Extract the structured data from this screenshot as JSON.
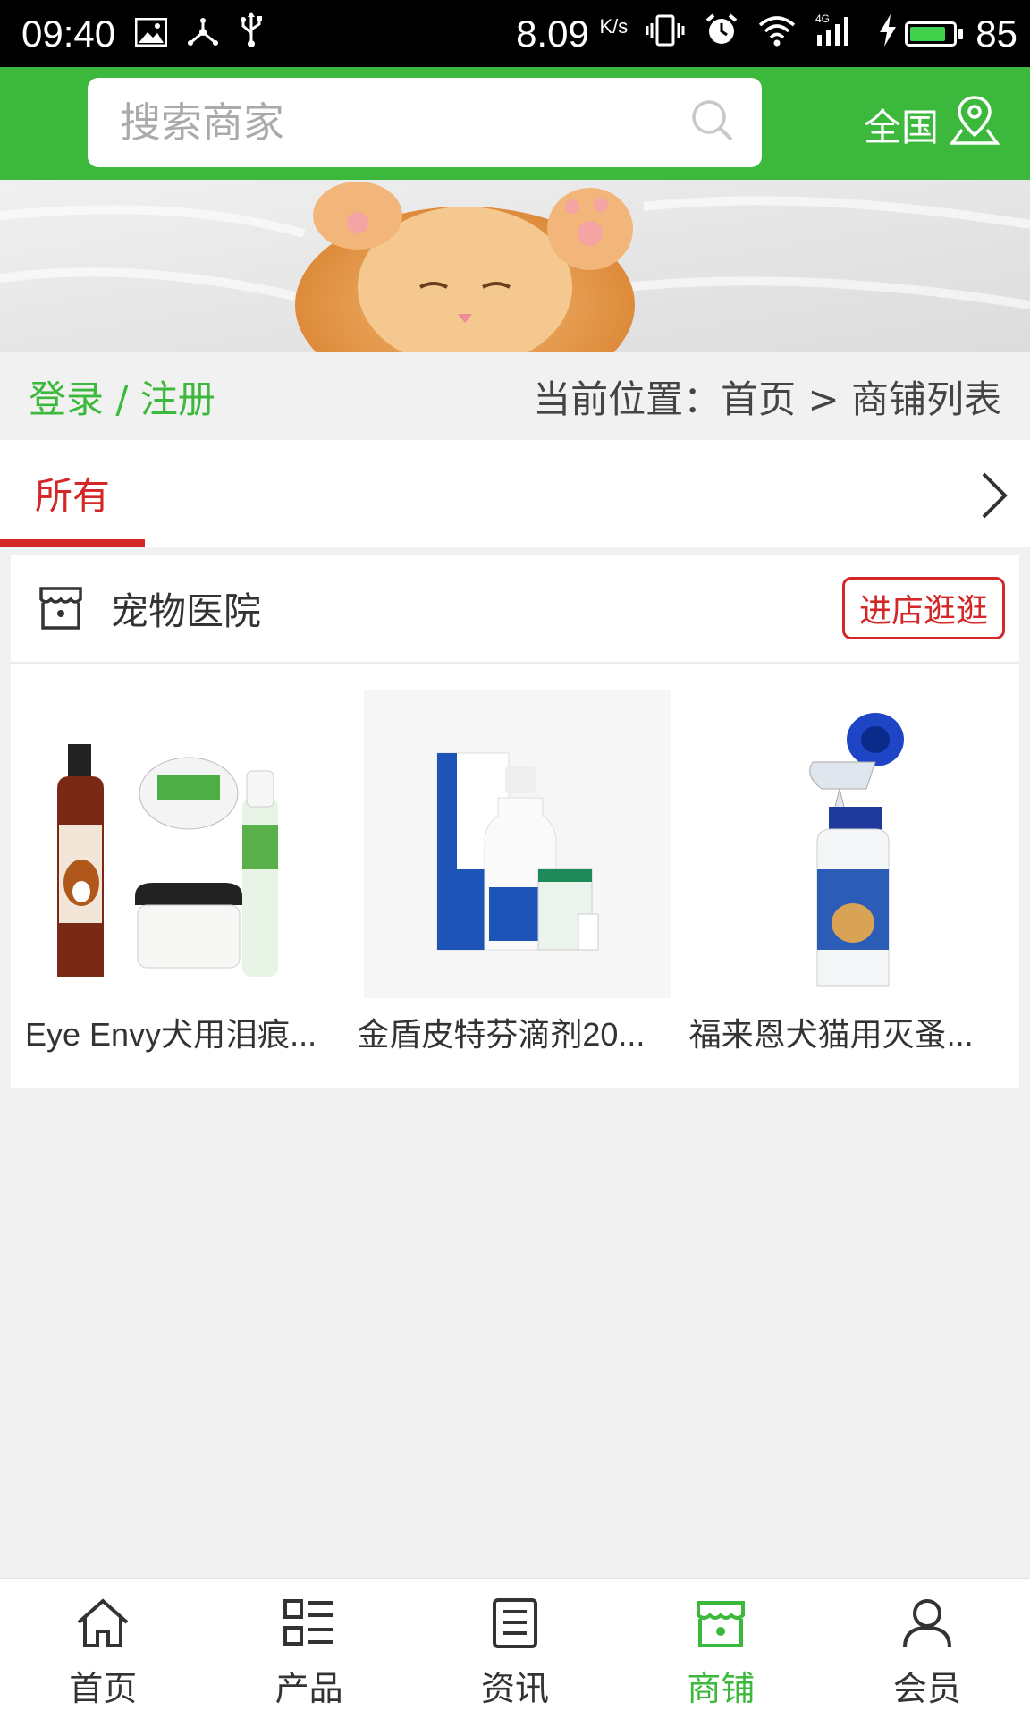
{
  "status_bar": {
    "time": "09:40",
    "speed": "8.09",
    "speed_unit": "K/s",
    "battery": "85",
    "battery_level": 0.85,
    "icons": [
      "image-icon",
      "share-network-icon",
      "usb-icon",
      "vibrate-icon",
      "alarm-icon",
      "wifi-icon",
      "signal-4g-icon",
      "charging-icon"
    ]
  },
  "header": {
    "search_placeholder": "搜索商家",
    "region_label": "全国",
    "accent_color": "#3cb93c"
  },
  "crumb": {
    "login_register": "登录 / 注册",
    "location": "当前位置：首页 > 商铺列表"
  },
  "tabs": {
    "active": "所有",
    "active_color": "#d42727"
  },
  "shop": {
    "name": "宠物医院",
    "visit_label": "进店逛逛",
    "products": [
      {
        "name": "Eye Envy犬用泪痕..."
      },
      {
        "name": "金盾皮特芬滴剂20..."
      },
      {
        "name": "福来恩犬猫用灭蚤..."
      }
    ]
  },
  "bottom_nav": [
    {
      "label": "首页",
      "icon": "home-icon"
    },
    {
      "label": "产品",
      "icon": "product-list-icon"
    },
    {
      "label": "资讯",
      "icon": "news-icon"
    },
    {
      "label": "商铺",
      "icon": "shop-icon",
      "active": true
    },
    {
      "label": "会员",
      "icon": "member-icon"
    }
  ]
}
